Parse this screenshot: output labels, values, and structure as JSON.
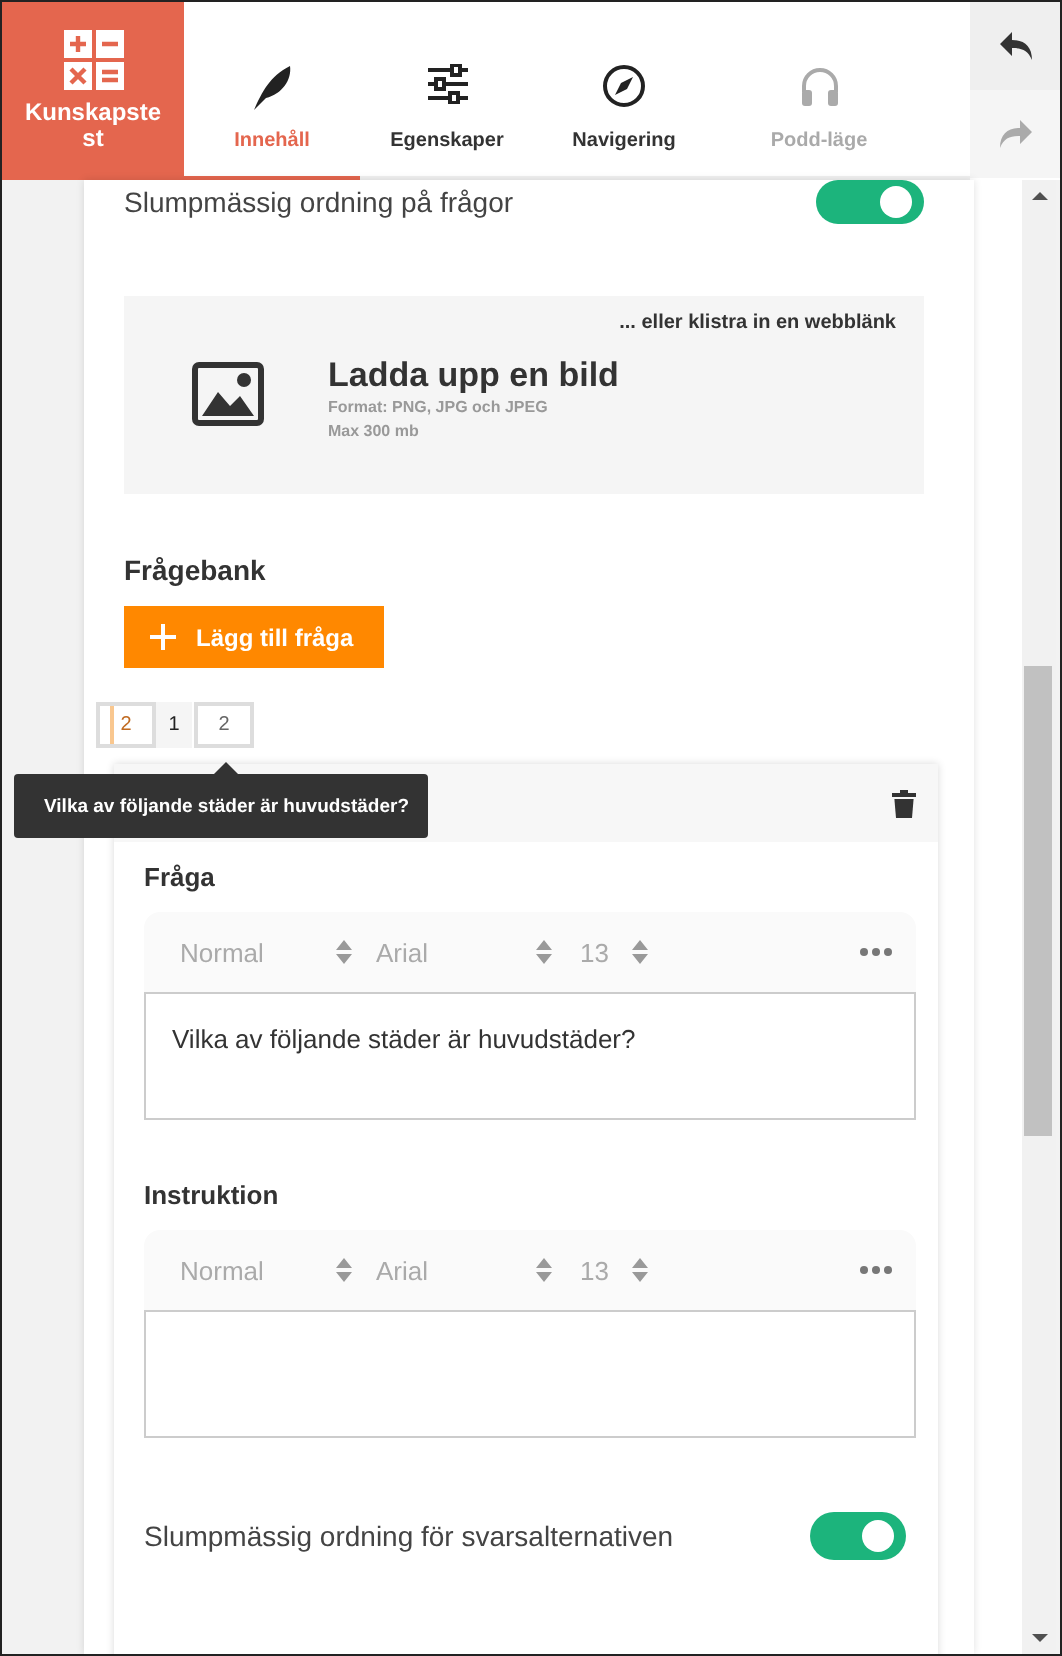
{
  "header": {
    "app_name": "Kunskapstest",
    "tabs": [
      {
        "label": "Innehåll",
        "selected": true,
        "disabled": false
      },
      {
        "label": "Egenskaper",
        "selected": false,
        "disabled": false
      },
      {
        "label": "Navigering",
        "selected": false,
        "disabled": false
      },
      {
        "label": "Podd-läge",
        "selected": false,
        "disabled": true
      }
    ]
  },
  "history": [
    {
      "kind": "undo",
      "disabled": false
    },
    {
      "kind": "redo",
      "disabled": true
    }
  ],
  "random_questions": {
    "label": "Slumpmässig ordning på frågor",
    "on": true
  },
  "upload": {
    "link_hint": "... eller klistra in en webblänk",
    "title": "Ladda upp en bild",
    "formats": "Format: PNG, JPG och JPEG",
    "max_size": "Max 300 mb"
  },
  "question_bank": {
    "title": "Frågebank",
    "add_button": "Lägg till fråga",
    "pages": [
      {
        "label": "2",
        "kind": "dragged"
      },
      {
        "label": "1",
        "kind": "page"
      },
      {
        "label": "2",
        "kind": "boxed"
      }
    ],
    "tooltip": "Vilka av följande städer är huvudstäder?"
  },
  "question": {
    "sections": [
      {
        "label": "Fråga",
        "toolbar": {
          "style": "Normal",
          "font": "Arial",
          "size": "13"
        },
        "value": "Vilka av följande städer är huvudstäder?"
      },
      {
        "label": "Instruktion",
        "toolbar": {
          "style": "Normal",
          "font": "Arial",
          "size": "13"
        }
      }
    ],
    "shuffle_answers": {
      "label": "Slumpmässig ordning för svarsalternativen",
      "on": true
    }
  }
}
